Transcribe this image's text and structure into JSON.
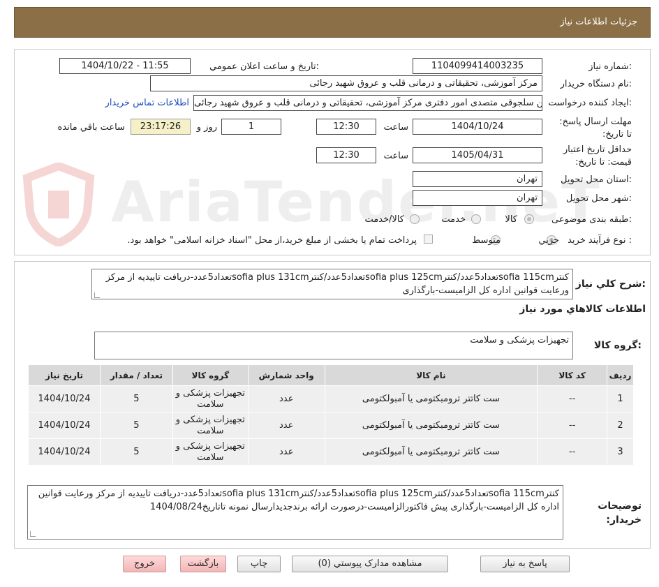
{
  "header": {
    "title": "جزئیات اطلاعات نیاز"
  },
  "watermark": {
    "text": "AriaTender.neT"
  },
  "form": {
    "need_number_label": "شماره نیاز:",
    "need_number_value": "1104099414003235",
    "announce_label": "تاریخ و ساعت اعلان عمومي:",
    "announce_value": "1404/10/22 - 11:55",
    "buyer_org_label": "نام دستگاه خريدار:",
    "buyer_org_value": "مرکز آموزشی، تحقیقاتی و درمانی قلب و عروق شهید رجائی",
    "requester_label": "ايجاد کننده درخواست:",
    "requester_value": "حسین سلجوقی متصدی امور دفتری مرکز آموزشی، تحقیقاتی و درمانی قلب و عروق شهید رجائی",
    "contact_link": "اطلاعات تماس خريدار",
    "deadline_label": "مهلت ارسال پاسخ: تا تاریخ:",
    "deadline_date": "1404/10/24",
    "deadline_time_label": "ساعت",
    "deadline_time": "12:30",
    "days_value": "1",
    "days_label": "روز و",
    "remaining_time": "23:17:26",
    "remaining_label": "ساعت باقي مانده",
    "validity_label": "حداقل تاريخ اعتبار قيمت: تا تاريخ:",
    "validity_date": "1405/04/31",
    "validity_time_label": "ساعت",
    "validity_time": "12:30",
    "province_label": "استان محل تحویل:",
    "province_value": "تهران",
    "city_label": "شهر محل تحویل:",
    "city_value": "تهران",
    "category_label": "طبقه بندی موضوعی:",
    "category_options": [
      "کالا",
      "خدمت",
      "کالا/خدمت"
    ],
    "process_label": "نوع فرآيند خريد :",
    "process_options": [
      "جزیي",
      "متوسط"
    ],
    "process_note": "پرداخت تمام یا بخشی از مبلغ خرید،از محل \"اسناد خزانه اسلامی\" خواهد بود."
  },
  "description": {
    "label": "شرح کلي نياز:",
    "text": "کنترsofia 115cmتعداد5عدد/کنترsofia plus 125cmتعداد5عدد/کنترsofia plus 131cmتعداد5عدد-دریافت تاییدیه از مرکز ورعایت قوانین اداره کل الزامیست-بارگذاری"
  },
  "goods_info": {
    "title": "اطلاعات کالاهاي مورد نياز",
    "group_label": "گروه کالا:",
    "group_value": "تجهیزات پزشکی و سلامت"
  },
  "table": {
    "headers": [
      "رديف",
      "کد کالا",
      "نام کالا",
      "واحد شمارش",
      "گروه کالا",
      "تعداد / مقدار",
      "تاريخ نياز"
    ],
    "rows": [
      [
        "1",
        "--",
        "ست کاتتر ترومبکتومی یا آمبولکتومی",
        "عدد",
        "تجهیزات پزشکی و سلامت",
        "5",
        "1404/10/24"
      ],
      [
        "2",
        "--",
        "ست کاتتر ترومبکتومی یا آمبولکتومی",
        "عدد",
        "تجهیزات پزشکی و سلامت",
        "5",
        "1404/10/24"
      ],
      [
        "3",
        "--",
        "ست کاتتر ترومبکتومی یا آمبولکتومی",
        "عدد",
        "تجهیزات پزشکی و سلامت",
        "5",
        "1404/10/24"
      ]
    ]
  },
  "buyer_notes": {
    "label": "توضيحات خريدار:",
    "text": "کنترsofia 115cmتعداد5عدد/کنترsofia plus 125cmتعداد5عدد/کنترsofia plus 131cmتعداد5عدد-دریافت تاییدیه از مرکز ورعایت قوانین اداره کل الزامیست-بارگذاری پیش فاکتورالزامیست-درصورت ارائه برندجدیدارسال نمونه تاتاریخ1404/08/24"
  },
  "buttons": {
    "reply": "پاسخ به نياز",
    "attachments": "مشاهده مدارک پيوستي (0)",
    "print": "چاپ",
    "back": "بازگشت",
    "exit": "خروج"
  },
  "colors": {
    "header_bg": "#8b6f47",
    "link": "#1a4dbb",
    "timer_bg": "#f5f0c8",
    "exit_bg": "#f2b6b6"
  }
}
